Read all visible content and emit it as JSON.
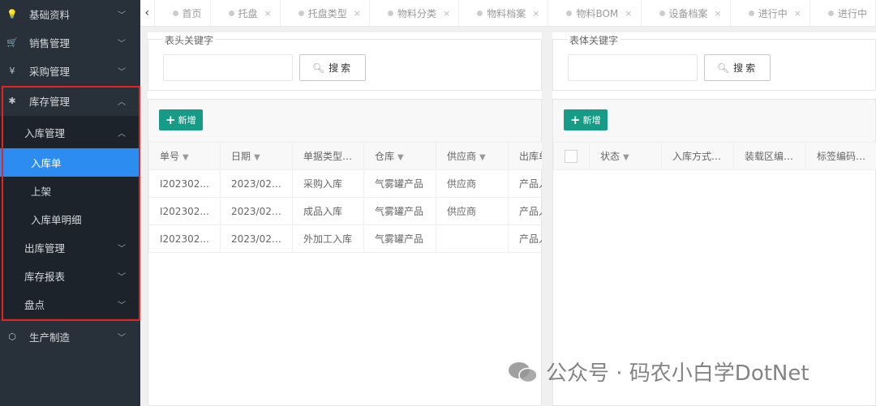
{
  "sidebar": {
    "items": [
      {
        "label": "基础资料",
        "icon": "lightbulb-icon"
      },
      {
        "label": "销售管理",
        "icon": "cart-icon"
      },
      {
        "label": "采购管理",
        "icon": "yen-icon"
      },
      {
        "label": "库存管理",
        "icon": "asterisk-icon"
      },
      {
        "label": "生产制造",
        "icon": "hex-icon"
      }
    ],
    "stock": {
      "inbound": "入库管理",
      "inbound_children": [
        "入库单",
        "上架",
        "入库单明细"
      ],
      "outbound": "出库管理",
      "report": "库存报表",
      "check": "盘点"
    }
  },
  "tabs": [
    {
      "label": "首页"
    },
    {
      "label": "托盘"
    },
    {
      "label": "托盘类型"
    },
    {
      "label": "物料分类"
    },
    {
      "label": "物料档案"
    },
    {
      "label": "物料BOM"
    },
    {
      "label": "设备档案"
    },
    {
      "label": "进行中"
    },
    {
      "label": "进行中"
    }
  ],
  "tab_close": "×",
  "left": {
    "legend": "表头关键字",
    "search_label": "搜索",
    "add_label": "新增",
    "columns": [
      "单号",
      "日期",
      "单据类型...",
      "仓库",
      "供应商",
      "出库单"
    ],
    "rows": [
      [
        "I202302...",
        "2023/02/...",
        "采购入库",
        "气雾罐产品",
        "供应商",
        "产品入库"
      ],
      [
        "I202302...",
        "2023/02/...",
        "成品入库",
        "气雾罐产品",
        "供应商",
        "产品入库"
      ],
      [
        "I202302...",
        "2023/02/...",
        "外加工入库",
        "气雾罐产品",
        "",
        "产品入库"
      ]
    ]
  },
  "right": {
    "legend": "表体关键字",
    "search_label": "搜索",
    "add_label": "新增",
    "columns": [
      "状态",
      "入库方式...",
      "装载区编...",
      "标签编码..."
    ]
  },
  "watermark": "公众号 · 码农小白学DotNet"
}
